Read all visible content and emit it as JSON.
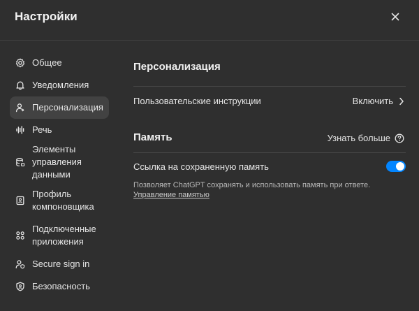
{
  "header": {
    "title": "Настройки"
  },
  "sidebar": {
    "items": [
      {
        "label": "Общее",
        "icon": "gear-icon"
      },
      {
        "label": "Уведомления",
        "icon": "bell-icon"
      },
      {
        "label": "Персонализация",
        "icon": "person-icon",
        "active": true
      },
      {
        "label": "Речь",
        "icon": "waveform-icon"
      },
      {
        "label": "Элементы управления данными",
        "line1": "Элементы",
        "line2": "управления",
        "line3": "данными",
        "icon": "database-icon"
      },
      {
        "label": "Профиль компоновщика",
        "line1": "Профиль",
        "line2": "компоновщика",
        "icon": "id-card-icon"
      },
      {
        "label": "Подключенные приложения",
        "line1": "Подключенные",
        "line2": "приложения",
        "icon": "apps-grid-icon"
      },
      {
        "label": "Secure sign in",
        "icon": "person-shield-icon"
      },
      {
        "label": "Безопасность",
        "icon": "shield-icon"
      }
    ]
  },
  "main": {
    "personalization": {
      "title": "Персонализация",
      "custom_instructions_label": "Пользовательские инструкции",
      "custom_instructions_action": "Включить"
    },
    "memory": {
      "title": "Память",
      "learn_more": "Узнать больше",
      "reference_label": "Ссылка на сохраненную память",
      "reference_enabled": true,
      "description": "Позволяет ChatGPT сохранять и использовать память при ответе.",
      "manage_link": "Управление памятью"
    }
  },
  "colors": {
    "background": "#2f2f2f",
    "active_item": "#424242",
    "toggle_on": "#0285ff",
    "divider": "#474747"
  }
}
